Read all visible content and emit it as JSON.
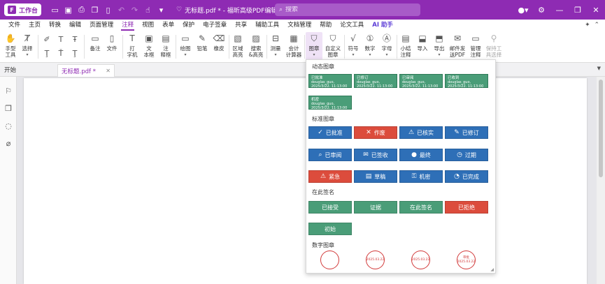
{
  "app": {
    "logo_label": "工作台",
    "logo_mark": "F",
    "doc_title": "无标题.pdf * - 福昕高级PDF编辑器"
  },
  "search": {
    "placeholder": "搜索"
  },
  "menu": {
    "items": [
      "文件",
      "主页",
      "转换",
      "编辑",
      "页面管理",
      "注释",
      "视图",
      "表单",
      "保护",
      "电子签章",
      "共享",
      "辅助工具",
      "文档管理",
      "帮助",
      "论文工具",
      "AI 助手"
    ],
    "active": "注释"
  },
  "ribbon": {
    "hand_tool": "手型\n工具",
    "select": "选择",
    "note": "备注",
    "file": "文件",
    "typewriter": "打\n字机",
    "textbox": "文\n本框",
    "callout": "注\n释框",
    "drawing": "绘图",
    "pencil": "铅笔",
    "eraser": "橡皮",
    "area_highlight": "区域\n高亮",
    "search_highlight": "搜索\n&高亮",
    "measure": "测量",
    "calculator": "会计\n计算器",
    "stamp": "图章",
    "custom_stamp": "自定义\n图章",
    "symbol": "符号",
    "number": "数字",
    "letter": "字母",
    "summarize": "小结\n注释",
    "import": "导入",
    "export": "导出",
    "email": "邮件发\n送PDF",
    "manage": "管理\n注释",
    "keep_tool": "保持工\n具选择"
  },
  "tabs": {
    "start": "开始",
    "doc": "无标题.pdf *"
  },
  "stamp_panel": {
    "dynamic_title": "动态图章",
    "dynamic": [
      {
        "label": "已批准",
        "meta": "douglas_guo, 2025/3/22, 11:13:00"
      },
      {
        "label": "已修订",
        "meta": "douglas_guo, 2025/3/22, 11:13:00"
      },
      {
        "label": "已审阅",
        "meta": "douglas_guo, 2025/3/22, 11:13:00"
      },
      {
        "label": "已收到",
        "meta": "douglas_guo, 2025/3/22, 11:13:00"
      },
      {
        "label": "机密",
        "meta": "douglas_guo, 2025/3/22, 11:13:00"
      }
    ],
    "standard_title": "标准图章",
    "standard": [
      {
        "label": "已批准",
        "icon": "check-icon",
        "glyph": "✓",
        "color": "blue"
      },
      {
        "label": "作废",
        "icon": "cross-icon",
        "glyph": "✕",
        "color": "red"
      },
      {
        "label": "已核实",
        "icon": "warning-icon",
        "glyph": "⚠",
        "color": "blue"
      },
      {
        "label": "已修订",
        "icon": "pencil-icon",
        "glyph": "✎",
        "color": "blue"
      },
      {
        "label": "已审阅",
        "icon": "magnifier-icon",
        "glyph": "⌕",
        "color": "blue"
      },
      {
        "label": "已签收",
        "icon": "envelope-icon",
        "glyph": "✉",
        "color": "blue"
      },
      {
        "label": "最终",
        "icon": "person-icon",
        "glyph": "●",
        "color": "blue"
      },
      {
        "label": "过期",
        "icon": "clock-icon",
        "glyph": "◷",
        "color": "blue"
      },
      {
        "label": "紧急",
        "icon": "warning-icon",
        "glyph": "⚠",
        "color": "red"
      },
      {
        "label": "草稿",
        "icon": "document-icon",
        "glyph": "▤",
        "color": "blue"
      },
      {
        "label": "机密",
        "icon": "lock-icon",
        "glyph": "🔒",
        "color": "blue"
      },
      {
        "label": "已完成",
        "icon": "done-icon",
        "glyph": "◔",
        "color": "blue"
      }
    ],
    "sign_title": "在此签名",
    "sign": [
      {
        "label": "已接受",
        "color": "green"
      },
      {
        "label": "证据",
        "color": "green"
      },
      {
        "label": "在此签名",
        "color": "green"
      },
      {
        "label": "已拒绝",
        "color": "red"
      },
      {
        "label": "初始",
        "color": "green"
      }
    ],
    "digital_title": "数字图章",
    "digital": [
      {
        "top": "",
        "date": ""
      },
      {
        "top": "",
        "date": "2025.03.22"
      },
      {
        "top": "",
        "date": "2025.03.22"
      },
      {
        "top": "审批",
        "date": "2025.03.22"
      }
    ]
  },
  "colors": {
    "brand": "#8e2bb3",
    "stamp_blue": "#2e6fb7",
    "stamp_red": "#dc4c3c",
    "stamp_green": "#4a9d78"
  }
}
